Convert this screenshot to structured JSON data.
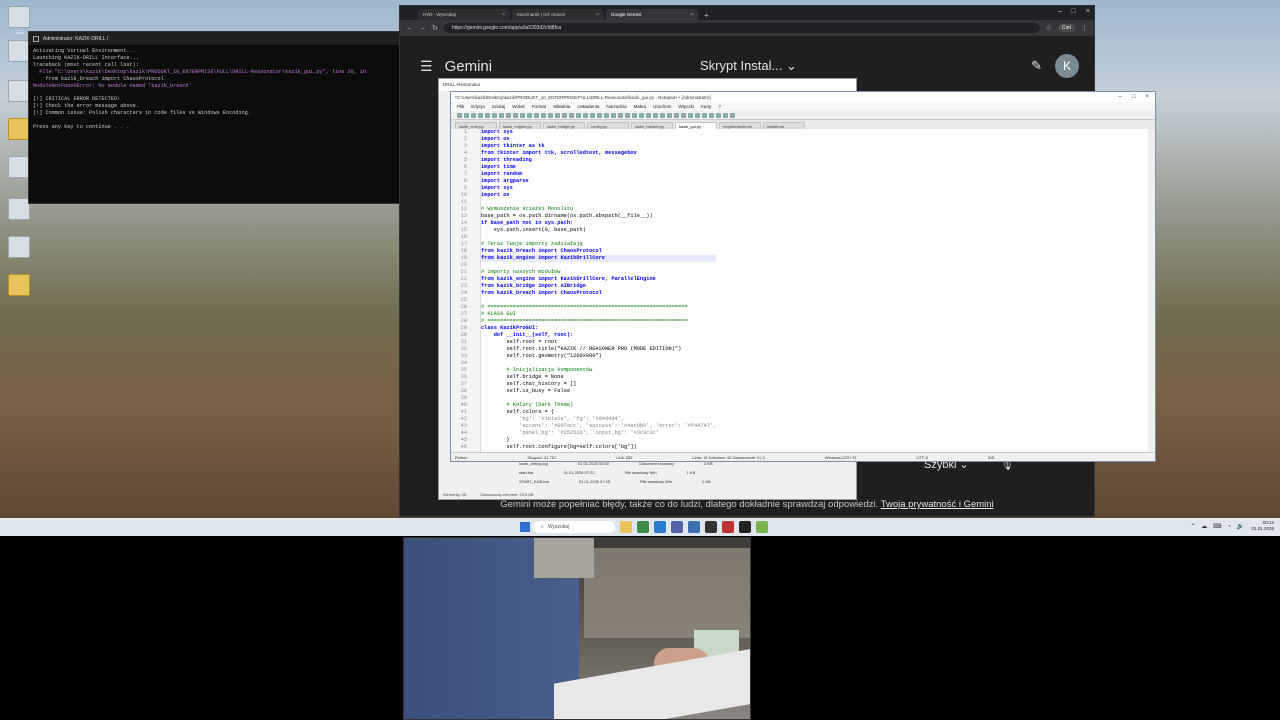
{
  "desktop": {
    "icons": [
      "Kosz",
      "",
      "",
      "",
      "",
      "",
      "",
      ""
    ]
  },
  "terminal": {
    "title": "Administrator: KAZIK-DRILL l",
    "lines": [
      {
        "text": "Activating Virtual Environment...",
        "cls": ""
      },
      {
        "text": "Launching KAZIK-DRILL Interface...",
        "cls": ""
      },
      {
        "text": "Traceback (most recent call last):",
        "cls": ""
      },
      {
        "text": "  File \"C:\\Users\\kazik\\Desktop\\kazik\\PRODUKT_10_ENTERPRISE\\FULL\\DRILL-Reasonator\\kazik_gui.py\", line 20, in",
        "cls": "t-mag"
      },
      {
        "text": "    from kazik_breach import ChaosProtocol",
        "cls": ""
      },
      {
        "text": "ModuleNotFoundError: No module named 'kazik_breach'",
        "cls": "t-mag"
      },
      {
        "text": "",
        "cls": ""
      },
      {
        "text": "[!] CRITICAL ERROR DETECTED!",
        "cls": ""
      },
      {
        "text": "[!] Check the error message above.",
        "cls": ""
      },
      {
        "text": "[!] Common issue: Polish characters in code files vs Windows Encoding.",
        "cls": ""
      },
      {
        "text": "",
        "cls": ""
      },
      {
        "text": "Press any key to continue . . .",
        "cls": ""
      }
    ]
  },
  "chrome": {
    "tabs": [
      {
        "label": "HVD - Wyszukaj",
        "active": false
      },
      {
        "label": "Kaczmarek | cel: reason",
        "active": false
      },
      {
        "label": "Google Gemini",
        "active": true
      }
    ],
    "url": "https://gemini.google.com/app/a0a5393d2cfd8fca",
    "profile": "Cori",
    "gemini": {
      "app_name": "Gemini",
      "chat_title": "Skrypt Instal...",
      "avatar_letter": "K",
      "mode": "Szybki",
      "footer_text": "Gemini może popełniać błędy, także co do ludzi, dlatego dokładnie sprawdzaj odpowiedzi.",
      "footer_link": "Twoja prywatność i Gemini"
    }
  },
  "np_back": {
    "title": "DRILL-Reasonator",
    "files": [
      {
        "name": "kazik_debug.log",
        "date": "01.01.2026 00:00",
        "type": "Dokument tekstowy",
        "size": "2 KB"
      },
      {
        "name": "start.bat",
        "date": "01.01.2026 07:22",
        "type": "Plik wsadowy Win",
        "size": "1 KB"
      },
      {
        "name": "START_KUB.bat",
        "date": "01.01.2026 07:25",
        "type": "Plik wsadowy Win",
        "size": "1 KB"
      }
    ],
    "status": [
      "Elementy: 26",
      "Zaznaczony element: 23,9 KB"
    ]
  },
  "notepad": {
    "title": "*C:\\Users\\kazik\\Desktop\\kazik\\PRODUKT_10_ENTERPRISE\\FULL\\DRILL-Reasonator\\kazik_gui.py - Notepad++ [Administrator]",
    "menu": [
      "Plik",
      "Edycja",
      "Szukaj",
      "Widok",
      "Format",
      "Składnia",
      "Ustawienia",
      "Narzędzia",
      "Makra",
      "Uruchom",
      "Wtyczki",
      "Karty",
      "?"
    ],
    "file_tabs": [
      {
        "label": "kazik_core.py",
        "active": false
      },
      {
        "label": "kazik_engine.py",
        "active": false
      },
      {
        "label": "kazik_bridge.py",
        "active": false
      },
      {
        "label": "config.py",
        "active": false
      },
      {
        "label": "kazik_breach.py",
        "active": false
      },
      {
        "label": "kazik_gui.py",
        "active": true
      },
      {
        "label": "requirements.txt",
        "active": false
      },
      {
        "label": "install.bat",
        "active": false
      }
    ],
    "code": [
      {
        "n": "1",
        "t": "import sys",
        "c": "kw1"
      },
      {
        "n": "2",
        "t": "import os",
        "c": "kw1"
      },
      {
        "n": "3",
        "t": "import tkinter as tk",
        "c": "kw1"
      },
      {
        "n": "4",
        "t": "from tkinter import ttk, scrolledtext, messagebox",
        "c": "kw1"
      },
      {
        "n": "5",
        "t": "import threading",
        "c": "kw1"
      },
      {
        "n": "6",
        "t": "import time",
        "c": "kw1"
      },
      {
        "n": "7",
        "t": "import random",
        "c": "kw1"
      },
      {
        "n": "8",
        "t": "import argparse",
        "c": "kw1"
      },
      {
        "n": "9",
        "t": "import sys",
        "c": "kw1"
      },
      {
        "n": "10",
        "t": "import os",
        "c": "kw1"
      },
      {
        "n": "11",
        "t": "",
        "c": ""
      },
      {
        "n": "12",
        "t": "# Wymuszenie ścieżki Monolitu",
        "c": "cm"
      },
      {
        "n": "13",
        "t": "base_path = os.path.dirname(os.path.abspath(__file__))",
        "c": ""
      },
      {
        "n": "14",
        "t": "if base_path not in sys.path:",
        "c": "kw1"
      },
      {
        "n": "15",
        "t": "    sys.path.insert(0, base_path)",
        "c": ""
      },
      {
        "n": "16",
        "t": "",
        "c": ""
      },
      {
        "n": "17",
        "t": "# Teraz Twoje importy zadziałają",
        "c": "cm"
      },
      {
        "n": "18",
        "t": "from kazik_breach import ChaosProtocol",
        "c": "kw1"
      },
      {
        "n": "19",
        "t": "from kazik_engine import KazikDrillCore",
        "c": "kw1 hl"
      },
      {
        "n": "20",
        "t": "",
        "c": ""
      },
      {
        "n": "21",
        "t": "# importy naszych modułów",
        "c": "cm"
      },
      {
        "n": "22",
        "t": "from kazik_engine import KazikDrillCore, ParallelEngine",
        "c": "kw1"
      },
      {
        "n": "23",
        "t": "from kazik_bridge import AIBridge",
        "c": "kw1"
      },
      {
        "n": "24",
        "t": "from kazik_breach import ChaosProtocol",
        "c": "kw1"
      },
      {
        "n": "25",
        "t": "",
        "c": ""
      },
      {
        "n": "26",
        "t": "# ===============================================================",
        "c": "cm"
      },
      {
        "n": "27",
        "t": "# KLASA GUI",
        "c": "cm"
      },
      {
        "n": "28",
        "t": "# ===============================================================",
        "c": "cm"
      },
      {
        "n": "29",
        "t": "class KazikProGUI:",
        "c": "kw1"
      },
      {
        "n": "30",
        "t": "    def __init__(self, root):",
        "c": "kw1"
      },
      {
        "n": "31",
        "t": "        self.root = root",
        "c": ""
      },
      {
        "n": "32",
        "t": "        self.root.title(\"KAZIK // REASONER PRO (MODE EDITION)\")",
        "c": ""
      },
      {
        "n": "33",
        "t": "        self.root.geometry(\"1200x800\")",
        "c": ""
      },
      {
        "n": "34",
        "t": "",
        "c": ""
      },
      {
        "n": "35",
        "t": "        # Inicjalizacja komponentów",
        "c": "cm"
      },
      {
        "n": "36",
        "t": "        self.bridge = None",
        "c": ""
      },
      {
        "n": "37",
        "t": "        self.chat_history = []",
        "c": ""
      },
      {
        "n": "38",
        "t": "        self.is_busy = False",
        "c": ""
      },
      {
        "n": "39",
        "t": "",
        "c": ""
      },
      {
        "n": "40",
        "t": "        # Kolory (Dark Theme)",
        "c": "cm"
      },
      {
        "n": "41",
        "t": "        self.colors = {",
        "c": ""
      },
      {
        "n": "42",
        "t": "            'bg': '#1e1e1e', 'fg': '#d4d4d4',",
        "c": "st"
      },
      {
        "n": "43",
        "t": "            'accent': '#007acc', 'success': '#4ec9b0', 'error': '#f44747',",
        "c": "st"
      },
      {
        "n": "44",
        "t": "            'panel_bg': '#252526', 'input_bg': '#3c3c3c'",
        "c": "st"
      },
      {
        "n": "45",
        "t": "        }",
        "c": ""
      },
      {
        "n": "46",
        "t": "        self.root.configure(bg=self.colors['bg'])",
        "c": ""
      }
    ],
    "status": {
      "lang": "Python",
      "length": "Długość: 21 767",
      "lines": "Linii: 509",
      "pos": "Linia: 19    Kolumna: 40    Zaznaczenie: 0 | 0",
      "eol": "Windows (CR LF)",
      "enc": "UTF-8",
      "ins": "INS"
    }
  },
  "taskbar": {
    "search": "Wyszukaj",
    "time": "00:13",
    "date": "01.01.2026"
  }
}
